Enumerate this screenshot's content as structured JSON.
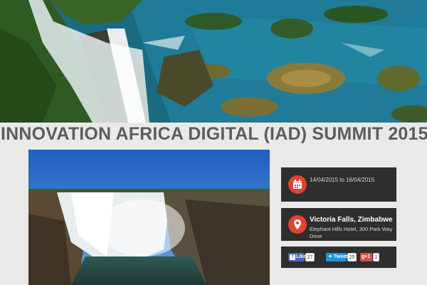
{
  "event": {
    "title": "INNOVATION AFRICA DIGITAL (IAD) SUMMIT 2015"
  },
  "date_card": {
    "icon": "calendar-icon",
    "dates": "14/04/2015 to 16/04/2015"
  },
  "location_card": {
    "icon": "map-pin-icon",
    "city": "Victoria Falls, Zimbabwe",
    "address": "Elephant Hills Hotel, 300 Park Way Drive"
  },
  "social": {
    "facebook": {
      "label": "Like",
      "count": "27"
    },
    "twitter": {
      "label": "Tweet",
      "count": "25"
    },
    "google": {
      "label": "g+1",
      "count": "1"
    }
  },
  "colors": {
    "page_bg": "#e9e9e7",
    "title": "#5d5d5d",
    "card_bg": "#2e2e2e",
    "icon_accent": "#e0432f"
  }
}
